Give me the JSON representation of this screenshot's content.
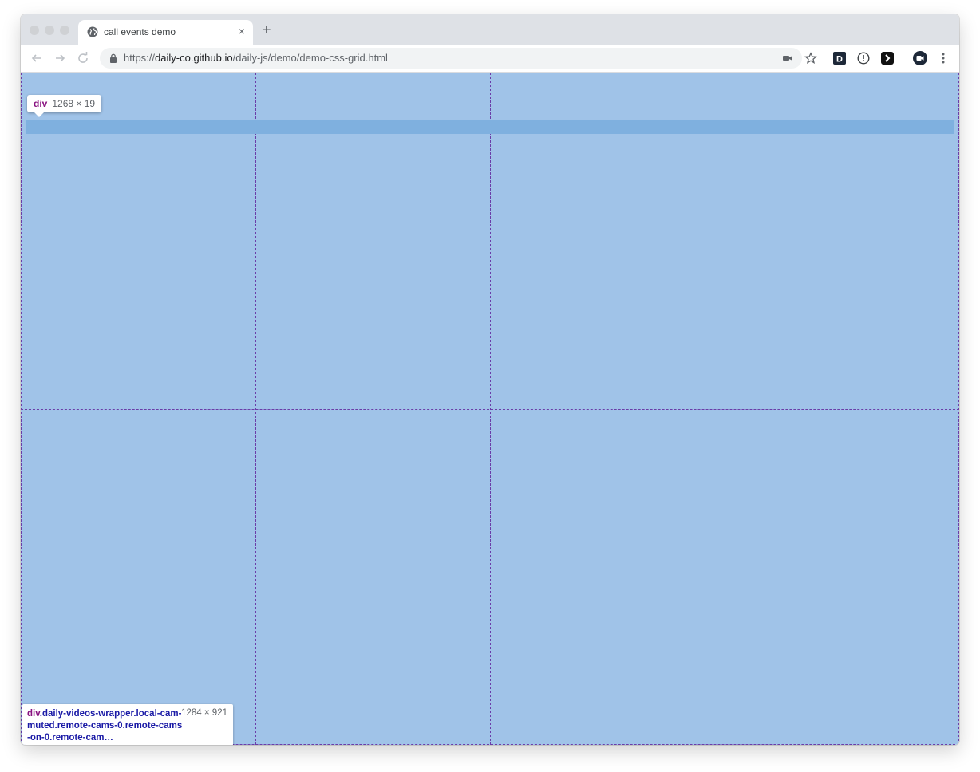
{
  "browser": {
    "tab_title": "call events demo",
    "tab_close": "×",
    "new_tab": "+",
    "url_scheme": "https://",
    "url_host": "daily-co.github.io",
    "url_path": "/daily-js/demo/demo-css-grid.html",
    "extensions": [
      "camera-icon",
      "star-icon",
      "d-extension-icon",
      "info-extension-icon",
      "arrow-extension-icon",
      "profile-avatar-icon",
      "kebab-menu-icon"
    ]
  },
  "devtools_overlay": {
    "top_tooltip": {
      "tag": "div",
      "size": "1268 × 19"
    },
    "bottom_tooltip": {
      "tag": "div",
      "classes": ".daily-videos-wrapper.local-cam-muted.remote-cams-0.remote-cams-on-0.remote-cam…",
      "size": "1284 × 921"
    },
    "grid": {
      "columns": 4,
      "rows": 2
    },
    "colors": {
      "content": "#a0c3e8",
      "highlight": "#7fb0df",
      "grid_line": "#6a3da8"
    }
  }
}
